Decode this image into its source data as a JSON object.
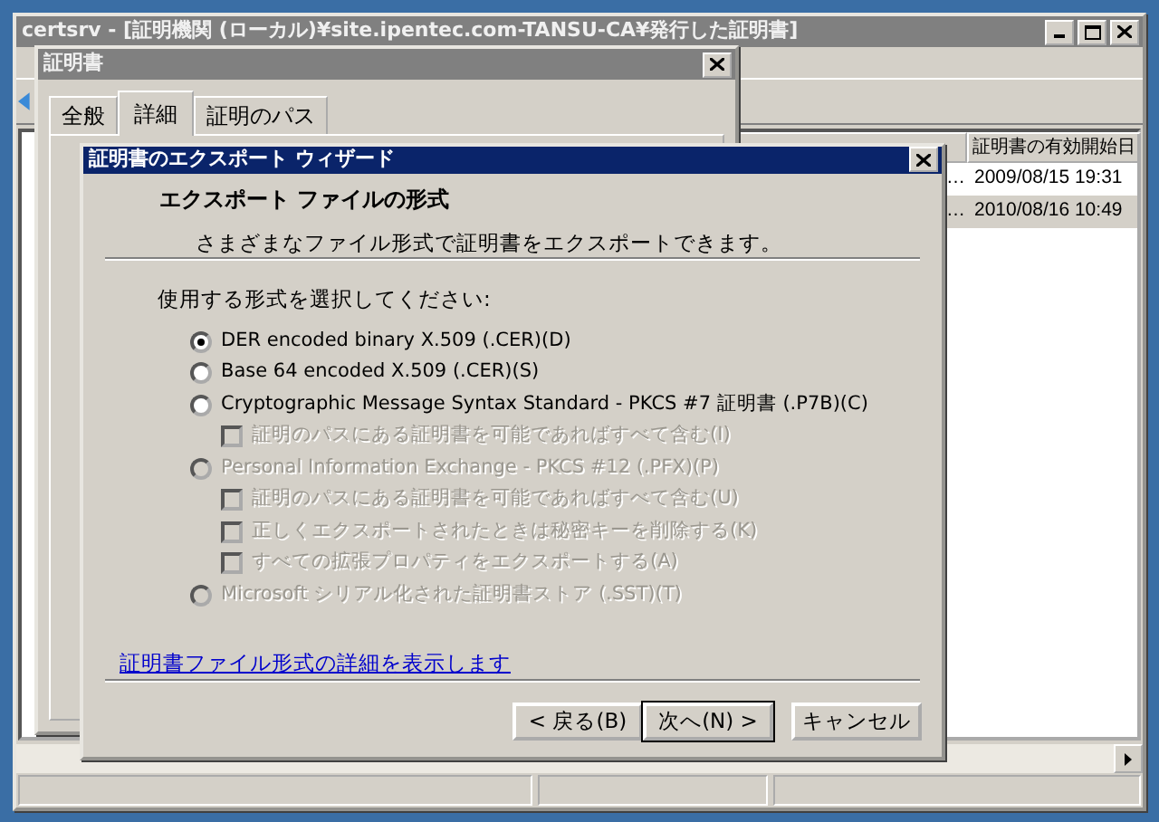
{
  "main_window": {
    "title": "certsrv - [証明機関 (ローカル)¥site.ipentec.com-TANSU-CA¥発行した証明書]",
    "list": {
      "columns": [
        {},
        {
          "label": "証明書の有効開始日"
        }
      ],
      "rows": [
        {
          "cells": [
            "…",
            "2009/08/15 19:31"
          ],
          "selected": false
        },
        {
          "cells": [
            "…",
            "2010/08/16 10:49"
          ],
          "selected": true
        }
      ]
    }
  },
  "certificate_dialog": {
    "title": "証明書",
    "tabs": [
      {
        "label": "全般",
        "selected": false
      },
      {
        "label": "詳細",
        "selected": true
      },
      {
        "label": "証明のパス",
        "selected": false
      }
    ]
  },
  "wizard": {
    "title": "証明書のエクスポート ウィザード",
    "heading": "エクスポート ファイルの形式",
    "subheading": "さまざまなファイル形式で証明書をエクスポートできます。",
    "prompt": "使用する形式を選択してください:",
    "options": [
      {
        "kind": "radio",
        "label": "DER encoded binary X.509 (.CER)(D)",
        "checked": true,
        "disabled": false
      },
      {
        "kind": "radio",
        "label": "Base 64 encoded X.509 (.CER)(S)",
        "checked": false,
        "disabled": false
      },
      {
        "kind": "radio",
        "label": "Cryptographic Message Syntax Standard - PKCS #7 証明書 (.P7B)(C)",
        "checked": false,
        "disabled": false,
        "children": [
          {
            "kind": "checkbox",
            "label": "証明のパスにある証明書を可能であればすべて含む(I)",
            "checked": false,
            "disabled": true
          }
        ]
      },
      {
        "kind": "radio",
        "label": "Personal Information Exchange - PKCS #12 (.PFX)(P)",
        "checked": false,
        "disabled": true,
        "children": [
          {
            "kind": "checkbox",
            "label": "証明のパスにある証明書を可能であればすべて含む(U)",
            "checked": false,
            "disabled": true
          },
          {
            "kind": "checkbox",
            "label": "正しくエクスポートされたときは秘密キーを削除する(K)",
            "checked": false,
            "disabled": true
          },
          {
            "kind": "checkbox",
            "label": "すべての拡張プロパティをエクスポートする(A)",
            "checked": false,
            "disabled": true
          }
        ]
      },
      {
        "kind": "radio",
        "label": "Microsoft シリアル化された証明書ストア (.SST)(T)",
        "checked": false,
        "disabled": true
      }
    ],
    "link": "証明書ファイル形式の詳細を表示します",
    "buttons": [
      {
        "label": "< 戻る(B)",
        "default": false
      },
      {
        "label": "次へ(N) >",
        "default": true
      },
      {
        "label": "キャンセル",
        "default": false
      }
    ]
  }
}
